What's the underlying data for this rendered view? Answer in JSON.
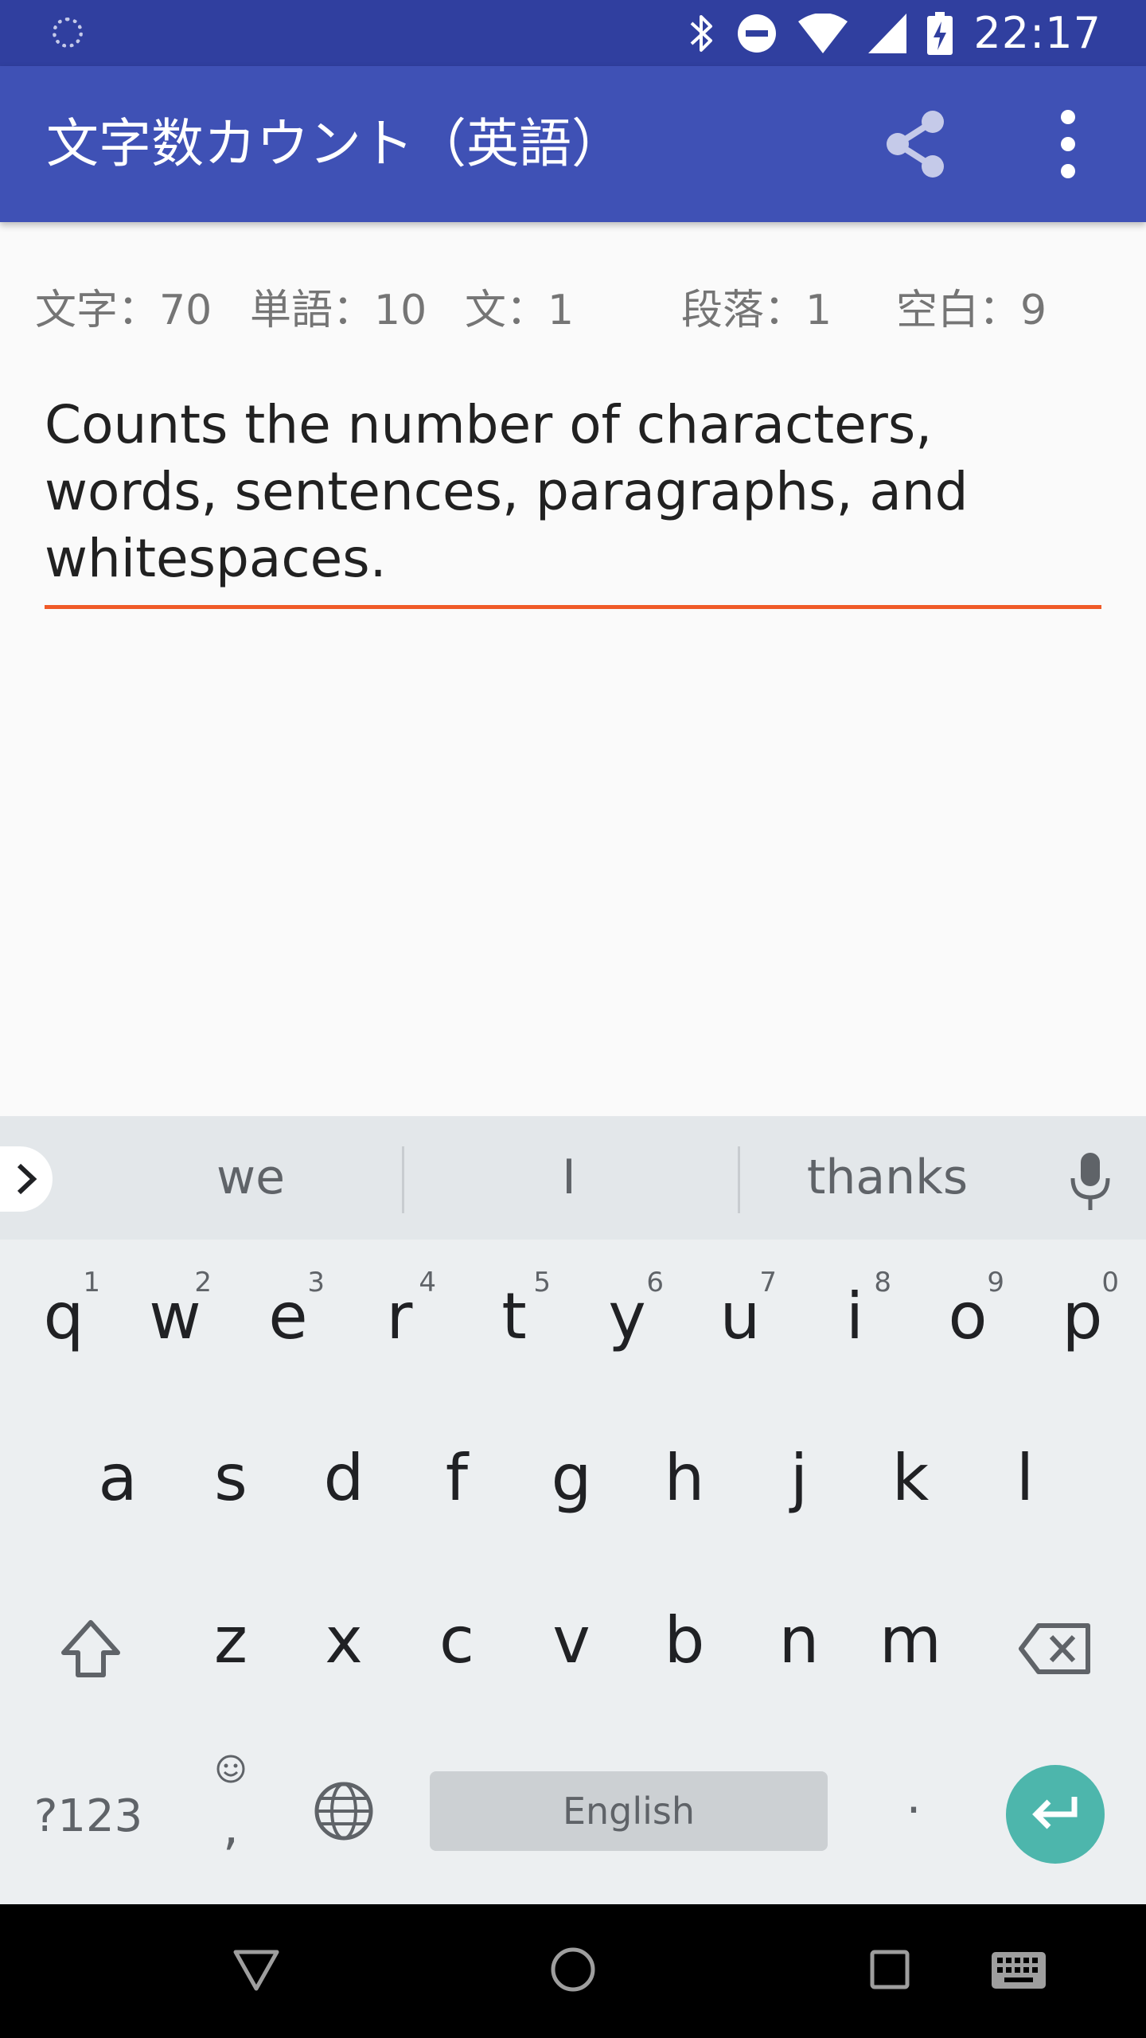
{
  "status_bar": {
    "time": "22:17",
    "icons": [
      "loading-indicator-icon",
      "bluetooth-icon",
      "do-not-disturb-icon",
      "wifi-icon",
      "cellular-signal-icon",
      "battery-charging-icon"
    ]
  },
  "app_bar": {
    "title": "文字数カウント（英語）",
    "actions": [
      "share-icon",
      "more-vert-icon"
    ]
  },
  "stats": {
    "characters": "文字：70",
    "words": "単語：10",
    "sentences": "文：1",
    "paragraphs": "段落：1",
    "whitespaces": "空白：9"
  },
  "editor": {
    "text": "Counts the number of characters, words, sentences, paragraphs, and whitespaces.",
    "accent_color": "#f05a28"
  },
  "keyboard": {
    "suggestions": [
      "we",
      "I",
      "thanks"
    ],
    "row1": [
      {
        "char": "q",
        "hint": "1"
      },
      {
        "char": "w",
        "hint": "2"
      },
      {
        "char": "e",
        "hint": "3"
      },
      {
        "char": "r",
        "hint": "4"
      },
      {
        "char": "t",
        "hint": "5"
      },
      {
        "char": "y",
        "hint": "6"
      },
      {
        "char": "u",
        "hint": "7"
      },
      {
        "char": "i",
        "hint": "8"
      },
      {
        "char": "o",
        "hint": "9"
      },
      {
        "char": "p",
        "hint": "0"
      }
    ],
    "row2": [
      "a",
      "s",
      "d",
      "f",
      "g",
      "h",
      "j",
      "k",
      "l"
    ],
    "row3": [
      "z",
      "x",
      "c",
      "v",
      "b",
      "n",
      "m"
    ],
    "symbols_label": "?123",
    "comma_label": ",",
    "space_label": "English",
    "period_label": ".",
    "enter_color": "#4db6ac"
  },
  "colors": {
    "status_bar": "#303f9f",
    "app_bar": "#3f51b5"
  }
}
